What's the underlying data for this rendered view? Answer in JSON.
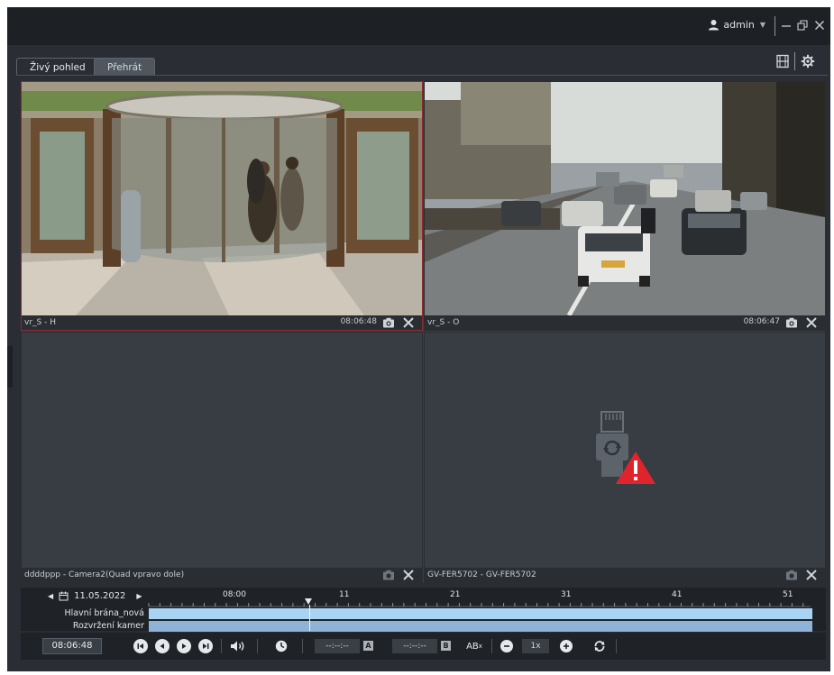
{
  "titlebar": {
    "username": "admin"
  },
  "tabs": [
    {
      "label": "Živý pohled",
      "active": true
    },
    {
      "label": "Přehrát",
      "active": false
    }
  ],
  "cells": [
    {
      "name": "vr_S - H",
      "time": "08:06:48",
      "selected": true,
      "state": "video"
    },
    {
      "name": "vr_S - O",
      "time": "08:06:47",
      "selected": false,
      "state": "video"
    },
    {
      "name": "ddddppp - Camera2(Quad vpravo dole)",
      "time": "",
      "selected": false,
      "state": "empty"
    },
    {
      "name": "GV-FER5702 - GV-FER5702",
      "time": "",
      "selected": false,
      "state": "disconnected"
    }
  ],
  "timeline": {
    "date": "11.05.2022",
    "ruler_labels": [
      "08:00",
      "11",
      "21",
      "31",
      "41",
      "51"
    ],
    "rows": [
      {
        "label": "Hlavní brána_nová",
        "color": "#a9d3f2"
      },
      {
        "label": "Rozvržení kamer",
        "color": "#8fb3d6"
      }
    ]
  },
  "controls": {
    "current_time": "08:06:48",
    "mark_a_time": "--:--:--",
    "mark_a_label": "A",
    "mark_b_time": "--:--:--",
    "mark_b_label": "B",
    "ab_label": "AB",
    "ab_sup": "x",
    "speed": "1x"
  },
  "colors": {
    "accent_selected_border": "#8b2a2e",
    "warning_red": "#e0242b",
    "timeline_bar": "#a9d3f2"
  }
}
